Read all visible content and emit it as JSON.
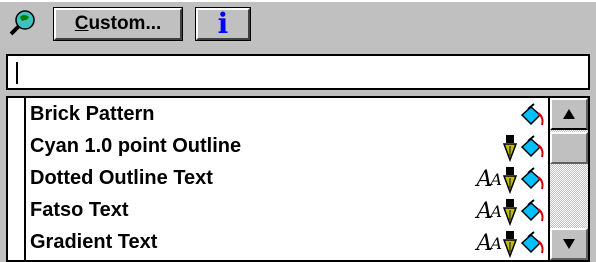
{
  "toolbar": {
    "globe_icon": "globe-icon",
    "custom_label_underlined": "C",
    "custom_label_rest": "ustom...",
    "info_icon": "info-icon",
    "info_glyph": "i"
  },
  "name_field": {
    "value": ""
  },
  "list": {
    "items": [
      {
        "label": "Brick Pattern",
        "icons": [
          "fill-bucket-icon"
        ]
      },
      {
        "label": "Cyan 1.0 point Outline",
        "icons": [
          "pen-nib-icon",
          "fill-bucket-icon"
        ]
      },
      {
        "label": "Dotted Outline Text",
        "icons": [
          "text-aa-icon",
          "pen-nib-icon",
          "fill-bucket-icon"
        ]
      },
      {
        "label": "Fatso Text",
        "icons": [
          "text-aa-icon",
          "pen-nib-icon",
          "fill-bucket-icon"
        ]
      },
      {
        "label": "Gradient Text",
        "icons": [
          "text-aa-icon",
          "pen-nib-icon",
          "fill-bucket-icon"
        ]
      }
    ],
    "aa_big": "A",
    "aa_small": "A"
  },
  "colors": {
    "info": "#0000ff",
    "bucket": "#00c0ff",
    "nib": "#c0c000"
  }
}
